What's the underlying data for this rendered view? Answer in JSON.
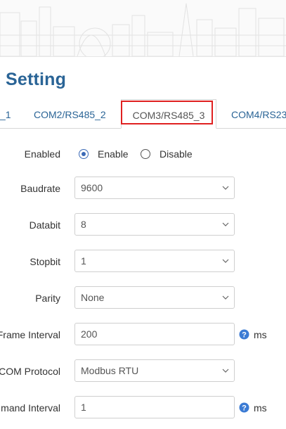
{
  "page": {
    "title": "Setting"
  },
  "tabs": [
    {
      "label": "_1"
    },
    {
      "label": "COM2/RS485_2"
    },
    {
      "label": "COM3/RS485_3",
      "active": true
    },
    {
      "label": "COM4/RS23"
    }
  ],
  "form": {
    "enabled": {
      "label": "Enabled",
      "options": [
        "Enable",
        "Disable"
      ],
      "selected": "Enable"
    },
    "baudrate": {
      "label": "Baudrate",
      "value": "9600"
    },
    "databit": {
      "label": "Databit",
      "value": "8"
    },
    "stopbit": {
      "label": "Stopbit",
      "value": "1"
    },
    "parity": {
      "label": "Parity",
      "value": "None"
    },
    "frame_interval": {
      "label": "Frame Interval",
      "value": "200",
      "unit": "ms"
    },
    "com_protocol": {
      "label": "COM Protocol",
      "value": "Modbus RTU"
    },
    "command_interval": {
      "label": "mand Interval",
      "value": "1",
      "unit": "ms"
    }
  },
  "colors": {
    "accent": "#2a6496",
    "highlight": "#e02020",
    "help": "#3b7bd4"
  },
  "icons": {
    "help": "help-icon",
    "select": "chevron-down-icon"
  }
}
